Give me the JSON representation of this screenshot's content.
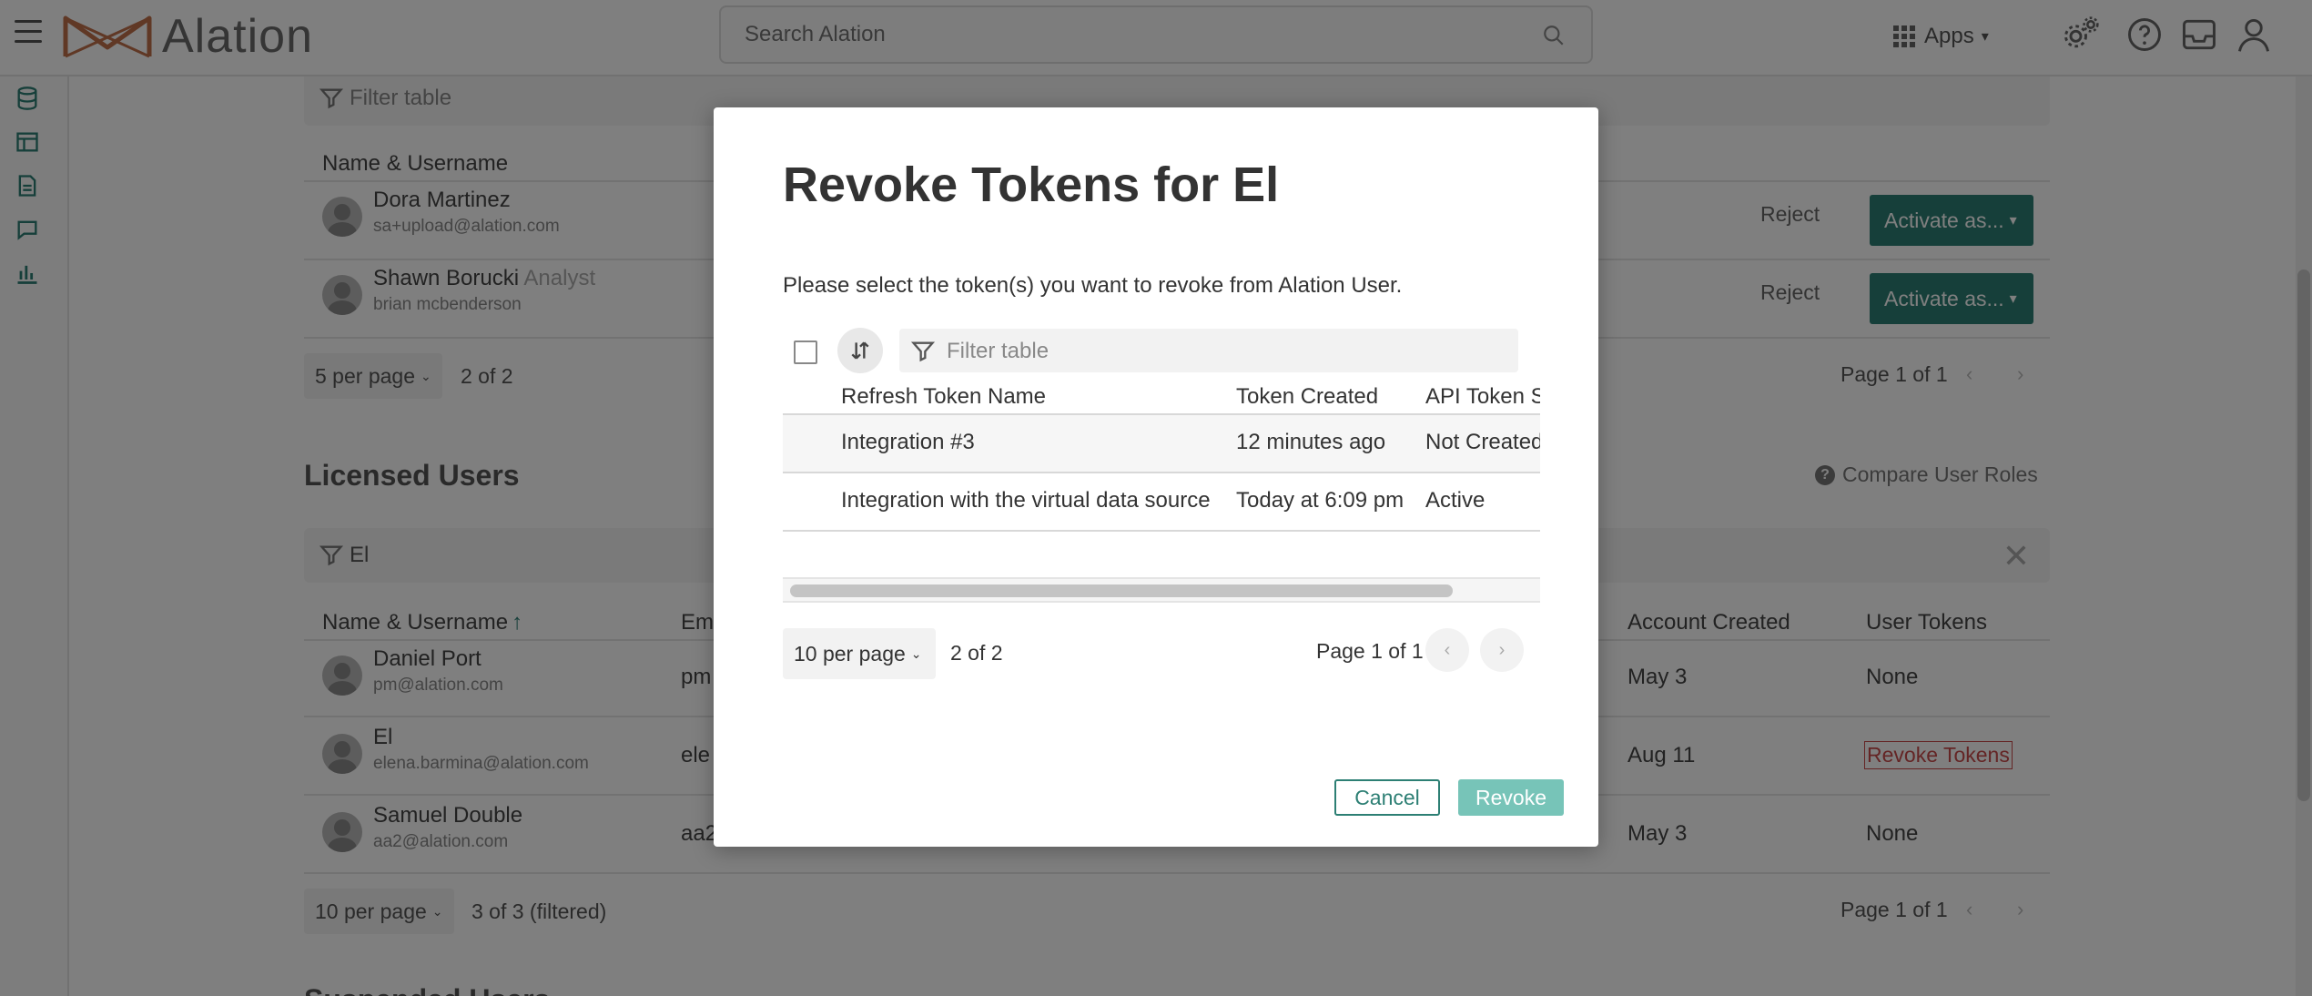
{
  "header": {
    "logo_text": "Alation",
    "search_placeholder": "Search Alation",
    "apps_label": "Apps"
  },
  "pending": {
    "filter_placeholder": "Filter table",
    "col_name": "Name & Username",
    "rows": [
      {
        "name": "Dora Martinez",
        "role": "",
        "email": "sa+upload@alation.com",
        "reject": "Reject",
        "activate": "Activate as..."
      },
      {
        "name": "Shawn Borucki",
        "role": "Analyst",
        "email": "brian mcbenderson",
        "reject": "Reject",
        "activate": "Activate as..."
      }
    ],
    "per_page": "5 per page",
    "count": "2 of 2",
    "page_info": "Page 1 of 1"
  },
  "licensed": {
    "title": "Licensed Users",
    "compare_label": "Compare User Roles",
    "filter_value": "El",
    "cols": {
      "name": "Name & Username",
      "email": "Em",
      "created": "Account Created",
      "tokens": "User Tokens"
    },
    "rows": [
      {
        "name": "Daniel Port",
        "email_short": "pm@alation.com",
        "email_col": "pm",
        "created": "May 3",
        "tokens": "None"
      },
      {
        "name": "El",
        "email_short": "elena.barmina@alation.com",
        "email_col": "ele",
        "created": "Aug 11",
        "tokens": "Revoke Tokens"
      },
      {
        "name": "Samuel Double",
        "email_short": "aa2@alation.com",
        "email_col": "aa2",
        "created": "May 3",
        "tokens": "None"
      }
    ],
    "per_page": "10 per page",
    "count": "3 of 3 (filtered)",
    "page_info": "Page 1 of 1",
    "next_section": "Suspended Users"
  },
  "modal": {
    "title": "Revoke Tokens for El",
    "description": "Please select the token(s) you want to revoke from Alation User.",
    "filter_placeholder": "Filter table",
    "columns": [
      "Refresh Token Name",
      "Token Created",
      "API Token S"
    ],
    "rows": [
      {
        "name": "Integration #3",
        "created": "12 minutes ago",
        "status": "Not Created"
      },
      {
        "name": "Integration with the virtual data source",
        "created": "Today at 6:09 pm",
        "status": "Active"
      }
    ],
    "per_page": "10 per page",
    "count": "2 of 2",
    "page_info": "Page 1 of 1",
    "cancel_label": "Cancel",
    "revoke_label": "Revoke"
  },
  "colors": {
    "accent": "#2d7f74",
    "revoke_button": "#77c4b8",
    "danger": "#c94a4a",
    "logo": "#c0704a"
  }
}
